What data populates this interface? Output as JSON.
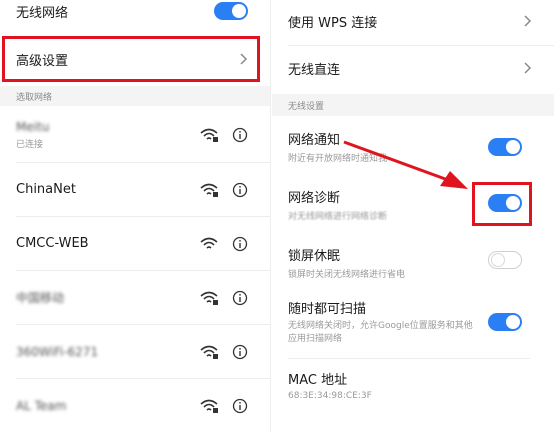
{
  "left": {
    "wlan_label": "无线网络",
    "advanced_label": "高级设置",
    "section_label": "选取网络",
    "networks": [
      {
        "name": "Meitu",
        "status": "已连接",
        "blurred": true
      },
      {
        "name": "ChinaNet",
        "status": "",
        "blurred": false
      },
      {
        "name": "CMCC-WEB",
        "status": "",
        "blurred": false
      },
      {
        "name": "中国移动",
        "status": "",
        "blurred": true
      },
      {
        "name": "360WiFi-6271",
        "status": "",
        "blurred": true
      },
      {
        "name": "AL Team",
        "status": "",
        "blurred": true
      }
    ]
  },
  "right": {
    "wps_label": "使用 WPS 连接",
    "direct_label": "无线直连",
    "section_label": "无线设置",
    "notify_title": "网络通知",
    "notify_sub": "附近有开放网络时通知我",
    "diag_title": "网络诊断",
    "diag_sub": "对无线网络进行网络诊断",
    "sleep_title": "锁屏休眠",
    "sleep_sub": "锁屏时关闭无线网络进行省电",
    "scan_title": "随时都可扫描",
    "scan_sub": "无线网络关闭时，允许Google位置服务和其他应用扫描网络",
    "mac_title": "MAC 地址",
    "mac_value": "68:3E:34:98:CE:3F"
  },
  "colors": {
    "accent": "#2b7ff5",
    "highlight": "#e0141e"
  }
}
